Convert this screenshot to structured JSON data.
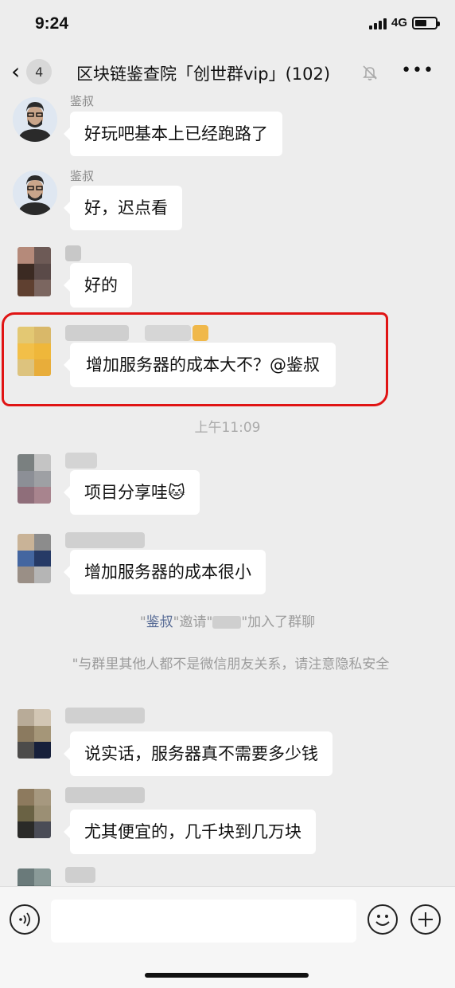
{
  "status": {
    "time": "9:24",
    "network": "4G"
  },
  "nav": {
    "unread_count": "4",
    "title": "区块链鉴查院「创世群vip」(102)"
  },
  "messages": [
    {
      "sender": "鉴叔",
      "text": "好玩吧基本上已经跑路了"
    },
    {
      "sender": "鉴叔",
      "text": "好，迟点看"
    },
    {
      "text": "好的"
    },
    {
      "text": "增加服务器的成本大不？@鉴叔"
    },
    {
      "text": "项目分享哇🐱"
    },
    {
      "text": "增加服务器的成本很小"
    },
    {
      "text": "说实话，服务器真不需要多少钱"
    },
    {
      "text": "尤其便宜的，几千块到几万块"
    }
  ],
  "timestamp": "上午11:09",
  "system": {
    "invite_quote_open": "\"",
    "inviter": "鉴叔",
    "invite_mid": "\"邀请\"",
    "invite_end": "\"加入了群聊",
    "notice": "\"与群里其他人都不是微信朋友关系，请注意隐私安全"
  },
  "icons": {
    "back": "chevron-left-icon",
    "mute": "bell-off-icon",
    "more": "more-icon",
    "voice": "voice-icon",
    "emoji": "emoji-icon",
    "plus": "plus-icon"
  }
}
